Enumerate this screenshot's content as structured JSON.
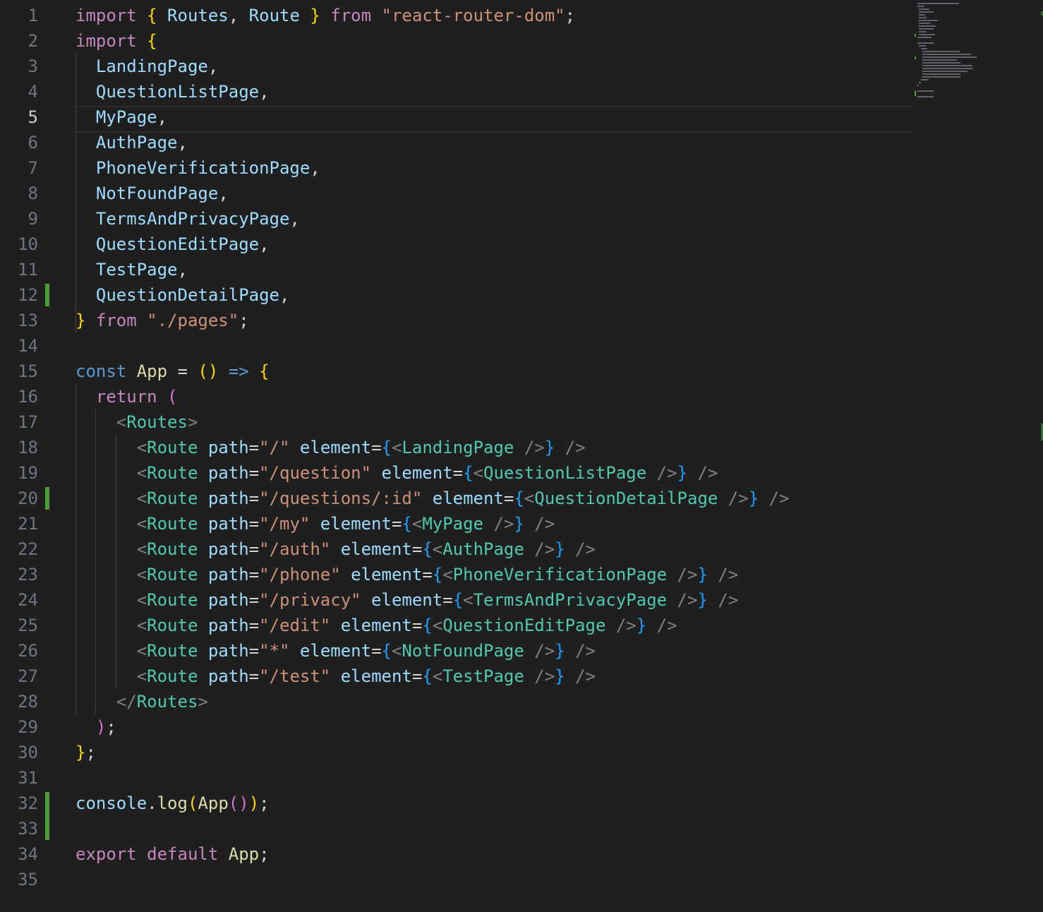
{
  "editor": {
    "current_line": 5,
    "lines": [
      {
        "n": "1",
        "tokens": [
          [
            "import",
            "kw-import"
          ],
          [
            " ",
            "punc"
          ],
          [
            "{",
            "br1"
          ],
          [
            " Routes",
            "var"
          ],
          [
            ", ",
            "punc"
          ],
          [
            "Route",
            "var"
          ],
          [
            " ",
            "punc"
          ],
          [
            "}",
            "br1"
          ],
          [
            " from ",
            "kw-import"
          ],
          [
            "\"react-router-dom\"",
            "str"
          ],
          [
            ";",
            "punc"
          ]
        ]
      },
      {
        "n": "2",
        "tokens": [
          [
            "import",
            "kw-import"
          ],
          [
            " ",
            "punc"
          ],
          [
            "{",
            "br1"
          ]
        ]
      },
      {
        "n": "3",
        "tokens": [
          [
            "  LandingPage",
            "var"
          ],
          [
            ",",
            "punc"
          ]
        ]
      },
      {
        "n": "4",
        "tokens": [
          [
            "  QuestionListPage",
            "var"
          ],
          [
            ",",
            "punc"
          ]
        ]
      },
      {
        "n": "5",
        "tokens": [
          [
            "  MyPage",
            "var"
          ],
          [
            ",",
            "punc"
          ]
        ]
      },
      {
        "n": "6",
        "tokens": [
          [
            "  AuthPage",
            "var"
          ],
          [
            ",",
            "punc"
          ]
        ]
      },
      {
        "n": "7",
        "tokens": [
          [
            "  PhoneVerificationPage",
            "var"
          ],
          [
            ",",
            "punc"
          ]
        ]
      },
      {
        "n": "8",
        "tokens": [
          [
            "  NotFoundPage",
            "var"
          ],
          [
            ",",
            "punc"
          ]
        ]
      },
      {
        "n": "9",
        "tokens": [
          [
            "  TermsAndPrivacyPage",
            "var"
          ],
          [
            ",",
            "punc"
          ]
        ]
      },
      {
        "n": "10",
        "tokens": [
          [
            "  QuestionEditPage",
            "var"
          ],
          [
            ",",
            "punc"
          ]
        ]
      },
      {
        "n": "11",
        "tokens": [
          [
            "  TestPage",
            "var"
          ],
          [
            ",",
            "punc"
          ]
        ]
      },
      {
        "n": "12",
        "tokens": [
          [
            "  QuestionDetailPage",
            "var"
          ],
          [
            ",",
            "punc"
          ]
        ]
      },
      {
        "n": "13",
        "tokens": [
          [
            "}",
            "br1"
          ],
          [
            " from ",
            "kw-import"
          ],
          [
            "\"./pages\"",
            "str"
          ],
          [
            ";",
            "punc"
          ]
        ]
      },
      {
        "n": "14",
        "tokens": []
      },
      {
        "n": "15",
        "tokens": [
          [
            "const",
            "kw-decl"
          ],
          [
            " ",
            "punc"
          ],
          [
            "App",
            "fn"
          ],
          [
            " = ",
            "op"
          ],
          [
            "()",
            "br1"
          ],
          [
            " ",
            "punc"
          ],
          [
            "=>",
            "arrow"
          ],
          [
            " ",
            "punc"
          ],
          [
            "{",
            "br1"
          ]
        ]
      },
      {
        "n": "16",
        "tokens": [
          [
            "  return",
            "kw-import"
          ],
          [
            " ",
            "punc"
          ],
          [
            "(",
            "br2"
          ]
        ]
      },
      {
        "n": "17",
        "tokens": [
          [
            "    <",
            "tag"
          ],
          [
            "Routes",
            "comp"
          ],
          [
            ">",
            "tag"
          ]
        ]
      },
      {
        "n": "18",
        "tokens": [
          [
            "      <",
            "tag"
          ],
          [
            "Route",
            "comp"
          ],
          [
            " path",
            "var"
          ],
          [
            "=",
            "punc"
          ],
          [
            "\"/\"",
            "str"
          ],
          [
            " element",
            "var"
          ],
          [
            "=",
            "punc"
          ],
          [
            "{",
            "br3"
          ],
          [
            "<",
            "tag"
          ],
          [
            "LandingPage",
            "comp"
          ],
          [
            " />",
            "tag"
          ],
          [
            "}",
            "br3"
          ],
          [
            " />",
            "tag"
          ]
        ]
      },
      {
        "n": "19",
        "tokens": [
          [
            "      <",
            "tag"
          ],
          [
            "Route",
            "comp"
          ],
          [
            " path",
            "var"
          ],
          [
            "=",
            "punc"
          ],
          [
            "\"/question\"",
            "str"
          ],
          [
            " element",
            "var"
          ],
          [
            "=",
            "punc"
          ],
          [
            "{",
            "br3"
          ],
          [
            "<",
            "tag"
          ],
          [
            "QuestionListPage",
            "comp"
          ],
          [
            " />",
            "tag"
          ],
          [
            "}",
            "br3"
          ],
          [
            " />",
            "tag"
          ]
        ]
      },
      {
        "n": "20",
        "tokens": [
          [
            "      <",
            "tag"
          ],
          [
            "Route",
            "comp"
          ],
          [
            " path",
            "var"
          ],
          [
            "=",
            "punc"
          ],
          [
            "\"/questions/:id\"",
            "str"
          ],
          [
            " element",
            "var"
          ],
          [
            "=",
            "punc"
          ],
          [
            "{",
            "br3"
          ],
          [
            "<",
            "tag"
          ],
          [
            "QuestionDetailPage",
            "comp"
          ],
          [
            " />",
            "tag"
          ],
          [
            "}",
            "br3"
          ],
          [
            " />",
            "tag"
          ]
        ]
      },
      {
        "n": "21",
        "tokens": [
          [
            "      <",
            "tag"
          ],
          [
            "Route",
            "comp"
          ],
          [
            " path",
            "var"
          ],
          [
            "=",
            "punc"
          ],
          [
            "\"/my\"",
            "str"
          ],
          [
            " element",
            "var"
          ],
          [
            "=",
            "punc"
          ],
          [
            "{",
            "br3"
          ],
          [
            "<",
            "tag"
          ],
          [
            "MyPage",
            "comp"
          ],
          [
            " />",
            "tag"
          ],
          [
            "}",
            "br3"
          ],
          [
            " />",
            "tag"
          ]
        ]
      },
      {
        "n": "22",
        "tokens": [
          [
            "      <",
            "tag"
          ],
          [
            "Route",
            "comp"
          ],
          [
            " path",
            "var"
          ],
          [
            "=",
            "punc"
          ],
          [
            "\"/auth\"",
            "str"
          ],
          [
            " element",
            "var"
          ],
          [
            "=",
            "punc"
          ],
          [
            "{",
            "br3"
          ],
          [
            "<",
            "tag"
          ],
          [
            "AuthPage",
            "comp"
          ],
          [
            " />",
            "tag"
          ],
          [
            "}",
            "br3"
          ],
          [
            " />",
            "tag"
          ]
        ]
      },
      {
        "n": "23",
        "tokens": [
          [
            "      <",
            "tag"
          ],
          [
            "Route",
            "comp"
          ],
          [
            " path",
            "var"
          ],
          [
            "=",
            "punc"
          ],
          [
            "\"/phone\"",
            "str"
          ],
          [
            " element",
            "var"
          ],
          [
            "=",
            "punc"
          ],
          [
            "{",
            "br3"
          ],
          [
            "<",
            "tag"
          ],
          [
            "PhoneVerificationPage",
            "comp"
          ],
          [
            " />",
            "tag"
          ],
          [
            "}",
            "br3"
          ],
          [
            " />",
            "tag"
          ]
        ]
      },
      {
        "n": "24",
        "tokens": [
          [
            "      <",
            "tag"
          ],
          [
            "Route",
            "comp"
          ],
          [
            " path",
            "var"
          ],
          [
            "=",
            "punc"
          ],
          [
            "\"/privacy\"",
            "str"
          ],
          [
            " element",
            "var"
          ],
          [
            "=",
            "punc"
          ],
          [
            "{",
            "br3"
          ],
          [
            "<",
            "tag"
          ],
          [
            "TermsAndPrivacyPage",
            "comp"
          ],
          [
            " />",
            "tag"
          ],
          [
            "}",
            "br3"
          ],
          [
            " />",
            "tag"
          ]
        ]
      },
      {
        "n": "25",
        "tokens": [
          [
            "      <",
            "tag"
          ],
          [
            "Route",
            "comp"
          ],
          [
            " path",
            "var"
          ],
          [
            "=",
            "punc"
          ],
          [
            "\"/edit\"",
            "str"
          ],
          [
            " element",
            "var"
          ],
          [
            "=",
            "punc"
          ],
          [
            "{",
            "br3"
          ],
          [
            "<",
            "tag"
          ],
          [
            "QuestionEditPage",
            "comp"
          ],
          [
            " />",
            "tag"
          ],
          [
            "}",
            "br3"
          ],
          [
            " />",
            "tag"
          ]
        ]
      },
      {
        "n": "26",
        "tokens": [
          [
            "      <",
            "tag"
          ],
          [
            "Route",
            "comp"
          ],
          [
            " path",
            "var"
          ],
          [
            "=",
            "punc"
          ],
          [
            "\"*\"",
            "str"
          ],
          [
            " element",
            "var"
          ],
          [
            "=",
            "punc"
          ],
          [
            "{",
            "br3"
          ],
          [
            "<",
            "tag"
          ],
          [
            "NotFoundPage",
            "comp"
          ],
          [
            " />",
            "tag"
          ],
          [
            "}",
            "br3"
          ],
          [
            " />",
            "tag"
          ]
        ]
      },
      {
        "n": "27",
        "tokens": [
          [
            "      <",
            "tag"
          ],
          [
            "Route",
            "comp"
          ],
          [
            " path",
            "var"
          ],
          [
            "=",
            "punc"
          ],
          [
            "\"/test\"",
            "str"
          ],
          [
            " element",
            "var"
          ],
          [
            "=",
            "punc"
          ],
          [
            "{",
            "br3"
          ],
          [
            "<",
            "tag"
          ],
          [
            "TestPage",
            "comp"
          ],
          [
            " />",
            "tag"
          ],
          [
            "}",
            "br3"
          ],
          [
            " />",
            "tag"
          ]
        ]
      },
      {
        "n": "28",
        "tokens": [
          [
            "    </",
            "tag"
          ],
          [
            "Routes",
            "comp"
          ],
          [
            ">",
            "tag"
          ]
        ]
      },
      {
        "n": "29",
        "tokens": [
          [
            "  )",
            "br2"
          ],
          [
            ";",
            "punc"
          ]
        ]
      },
      {
        "n": "30",
        "tokens": [
          [
            "}",
            "br1"
          ],
          [
            ";",
            "punc"
          ]
        ]
      },
      {
        "n": "31",
        "tokens": []
      },
      {
        "n": "32",
        "tokens": [
          [
            "console",
            "var"
          ],
          [
            ".",
            "punc"
          ],
          [
            "log",
            "fn"
          ],
          [
            "(",
            "br1"
          ],
          [
            "App",
            "fn"
          ],
          [
            "()",
            "br2"
          ],
          [
            ")",
            "br1"
          ],
          [
            ";",
            "punc"
          ]
        ]
      },
      {
        "n": "33",
        "tokens": []
      },
      {
        "n": "34",
        "tokens": [
          [
            "export",
            "kw-import"
          ],
          [
            " ",
            "punc"
          ],
          [
            "default",
            "kw-import"
          ],
          [
            " ",
            "punc"
          ],
          [
            "App",
            "fn"
          ],
          [
            ";",
            "punc"
          ]
        ]
      },
      {
        "n": "35",
        "tokens": []
      }
    ]
  }
}
